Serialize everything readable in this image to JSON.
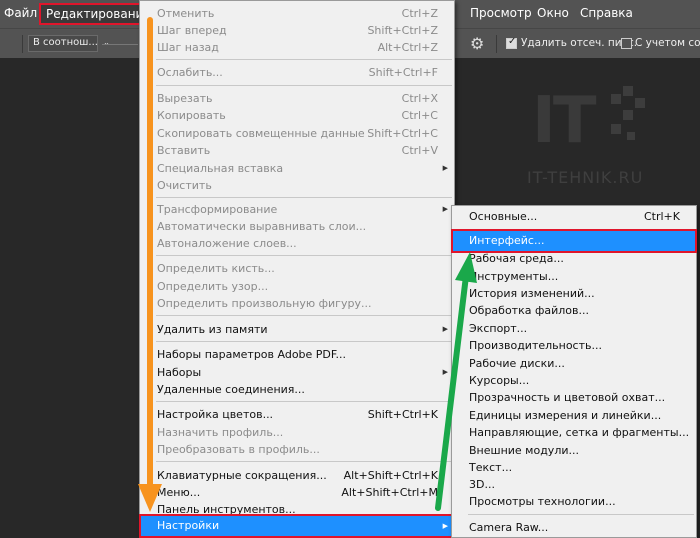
{
  "menubar": {
    "file": "Файл",
    "edit": "Редактирование",
    "view": "Просмотр",
    "window": "Окно",
    "help": "Справка"
  },
  "options": {
    "ratio": "В соотнош...",
    "delete_cropped": "Удалить отсеч. пикс.",
    "content_aware": "С учетом содер"
  },
  "logo": {
    "caption": "IT-TEHNIK.RU",
    "letters": "IT"
  },
  "edit_menu": {
    "undo": "Отменить",
    "undo_sc": "Ctrl+Z",
    "step_forward": "Шаг вперед",
    "step_forward_sc": "Shift+Ctrl+Z",
    "step_back": "Шаг назад",
    "step_back_sc": "Alt+Ctrl+Z",
    "fade": "Ослабить...",
    "fade_sc": "Shift+Ctrl+F",
    "cut": "Вырезать",
    "cut_sc": "Ctrl+X",
    "copy": "Копировать",
    "copy_sc": "Ctrl+C",
    "copy_merged": "Скопировать совмещенные данные",
    "copy_merged_sc": "Shift+Ctrl+C",
    "paste": "Вставить",
    "paste_sc": "Ctrl+V",
    "paste_special": "Специальная вставка",
    "clear": "Очистить",
    "transform": "Трансформирование",
    "auto_align": "Автоматически выравнивать слои...",
    "auto_blend": "Автоналожение слоев...",
    "define_brush": "Определить кисть...",
    "define_pattern": "Определить узор...",
    "define_shape": "Определить произвольную фигуру...",
    "purge": "Удалить из памяти",
    "pdf_presets": "Наборы параметров Adobe PDF...",
    "presets": "Наборы",
    "remote": "Удаленные соединения...",
    "color_settings": "Настройка цветов...",
    "color_settings_sc": "Shift+Ctrl+K",
    "assign_profile": "Назначить профиль...",
    "convert_profile": "Преобразовать в профиль...",
    "shortcuts": "Клавиатурные сокращения...",
    "shortcuts_sc": "Alt+Shift+Ctrl+K",
    "menus": "Меню...",
    "menus_sc": "Alt+Shift+Ctrl+M",
    "toolbar": "Панель инструментов...",
    "preferences": "Настройки"
  },
  "sub_menu": {
    "general": "Основные...",
    "general_sc": "Ctrl+K",
    "interface": "Интерфейс...",
    "workspace": "Рабочая среда...",
    "tools": "Инструменты...",
    "history": "История изменений...",
    "file_handling": "Обработка файлов...",
    "export": "Экспорт...",
    "performance": "Производительность...",
    "scratch": "Рабочие диски...",
    "cursors": "Курсоры...",
    "transparency": "Прозрачность и цветовой охват...",
    "units": "Единицы измерения и линейки...",
    "guides": "Направляющие, сетка и фрагменты...",
    "plugins": "Внешние модули...",
    "type": "Текст...",
    "three_d": "3D...",
    "tech_preview": "Просмотры технологии...",
    "camera_raw": "Camera Raw..."
  },
  "colors": {
    "highlight": "#1e90ff",
    "annotation_red": "#e0152b",
    "arrow_orange": "#f7931e",
    "arrow_green": "#1aa84a"
  }
}
